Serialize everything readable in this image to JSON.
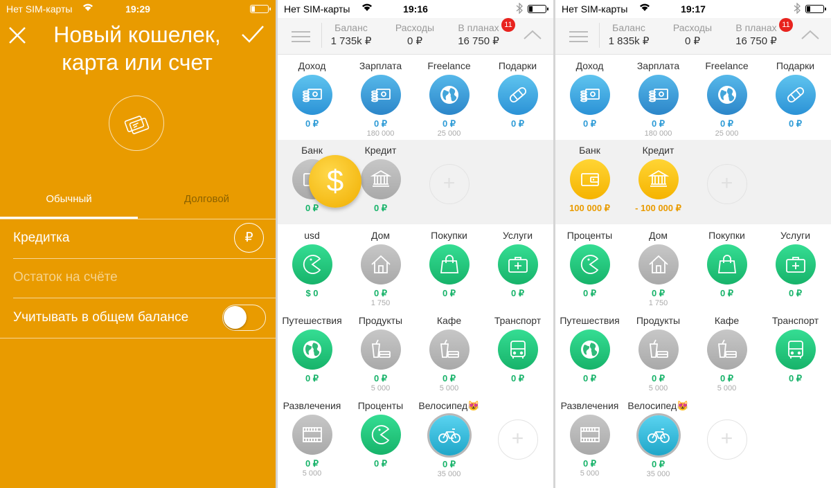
{
  "screen1": {
    "status": {
      "carrier": "Нет SIM-карты",
      "time": "19:29"
    },
    "title": "Новый кошелек, карта или счет",
    "tabs": [
      "Обычный",
      "Долговой"
    ],
    "name_value": "Кредитка",
    "currency_symbol": "₽",
    "balance_placeholder": "Остаток на счёте",
    "include_label": "Учитывать в общем балансе",
    "include_toggle": false
  },
  "screen2": {
    "status": {
      "carrier": "Нет SIM-карты",
      "time": "19:16"
    },
    "header": {
      "balance_label": "Баланс",
      "balance_value": "1 735k ₽",
      "expenses_label": "Расходы",
      "expenses_value": "0 ₽",
      "planned_label": "В планах",
      "planned_value": "16 750 ₽",
      "badge": "11"
    },
    "income": [
      {
        "name": "Доход",
        "value": "0 ₽",
        "sub": "",
        "icon": "cash-register-icon",
        "color": "blue"
      },
      {
        "name": "Зарплата",
        "value": "0 ₽",
        "sub": "180 000",
        "icon": "cash-register-icon",
        "color": "blue2"
      },
      {
        "name": "Freelance",
        "value": "0 ₽",
        "sub": "25 000",
        "icon": "globe-icon",
        "color": "blue2"
      },
      {
        "name": "Подарки",
        "value": "0 ₽",
        "sub": "",
        "icon": "bandage-icon",
        "color": "blue"
      }
    ],
    "accounts": [
      {
        "name": "Банк",
        "value": "0 ₽",
        "sub": "",
        "icon": "wallet-icon",
        "color": "grey"
      },
      {
        "name": "Кредит",
        "value": "0 ₽",
        "sub": "",
        "icon": "bank-icon",
        "color": "grey"
      }
    ],
    "drag_symbol": "$",
    "expenses": [
      {
        "name": "usd",
        "value": "$ 0",
        "sub": "",
        "icon": "pacman-icon",
        "color": "green"
      },
      {
        "name": "Дом",
        "value": "0 ₽",
        "sub": "1 750",
        "icon": "house-icon",
        "color": "grey"
      },
      {
        "name": "Покупки",
        "value": "0 ₽",
        "sub": "",
        "icon": "shopping-bag-icon",
        "color": "green"
      },
      {
        "name": "Услуги",
        "value": "0 ₽",
        "sub": "",
        "icon": "first-aid-icon",
        "color": "green"
      },
      {
        "name": "Путешествия",
        "value": "0 ₽",
        "sub": "",
        "icon": "globe-icon",
        "color": "green"
      },
      {
        "name": "Продукты",
        "value": "0 ₽",
        "sub": "5 000",
        "icon": "groceries-icon",
        "color": "grey"
      },
      {
        "name": "Кафе",
        "value": "0 ₽",
        "sub": "5 000",
        "icon": "groceries-icon",
        "color": "grey"
      },
      {
        "name": "Транспорт",
        "value": "0 ₽",
        "sub": "",
        "icon": "bus-icon",
        "color": "green"
      },
      {
        "name": "Развлечения",
        "value": "0 ₽",
        "sub": "5 000",
        "icon": "film-icon",
        "color": "grey"
      },
      {
        "name": "Проценты",
        "value": "0 ₽",
        "sub": "",
        "icon": "pacman-icon",
        "color": "green"
      },
      {
        "name": "Велосипед😻",
        "value": "0 ₽",
        "sub": "35 000",
        "icon": "bicycle-icon",
        "color": "teal"
      }
    ]
  },
  "screen3": {
    "status": {
      "carrier": "Нет SIM-карты",
      "time": "19:17"
    },
    "header": {
      "balance_label": "Баланс",
      "balance_value": "1 835k ₽",
      "expenses_label": "Расходы",
      "expenses_value": "0 ₽",
      "planned_label": "В планах",
      "planned_value": "16 750 ₽",
      "badge": "11"
    },
    "income": [
      {
        "name": "Доход",
        "value": "0 ₽",
        "sub": "",
        "icon": "cash-register-icon",
        "color": "blue"
      },
      {
        "name": "Зарплата",
        "value": "0 ₽",
        "sub": "180 000",
        "icon": "cash-register-icon",
        "color": "blue2"
      },
      {
        "name": "Freelance",
        "value": "0 ₽",
        "sub": "25 000",
        "icon": "globe-icon",
        "color": "blue2"
      },
      {
        "name": "Подарки",
        "value": "0 ₽",
        "sub": "",
        "icon": "bandage-icon",
        "color": "blue"
      }
    ],
    "accounts": [
      {
        "name": "Банк",
        "value": "100 000 ₽",
        "sub": "",
        "icon": "wallet-icon",
        "color": "yellow"
      },
      {
        "name": "Кредит",
        "value": "- 100 000 ₽",
        "sub": "",
        "icon": "bank-icon",
        "color": "yellow"
      }
    ],
    "expenses": [
      {
        "name": "Проценты",
        "value": "0 ₽",
        "sub": "",
        "icon": "pacman-icon",
        "color": "green"
      },
      {
        "name": "Дом",
        "value": "0 ₽",
        "sub": "1 750",
        "icon": "house-icon",
        "color": "grey"
      },
      {
        "name": "Покупки",
        "value": "0 ₽",
        "sub": "",
        "icon": "shopping-bag-icon",
        "color": "green"
      },
      {
        "name": "Услуги",
        "value": "0 ₽",
        "sub": "",
        "icon": "first-aid-icon",
        "color": "green"
      },
      {
        "name": "Путешествия",
        "value": "0 ₽",
        "sub": "",
        "icon": "globe-icon",
        "color": "green"
      },
      {
        "name": "Продукты",
        "value": "0 ₽",
        "sub": "5 000",
        "icon": "groceries-icon",
        "color": "grey"
      },
      {
        "name": "Кафе",
        "value": "0 ₽",
        "sub": "5 000",
        "icon": "groceries-icon",
        "color": "grey"
      },
      {
        "name": "Транспорт",
        "value": "0 ₽",
        "sub": "",
        "icon": "bus-icon",
        "color": "green"
      },
      {
        "name": "Развлечения",
        "value": "0 ₽",
        "sub": "5 000",
        "icon": "film-icon",
        "color": "grey"
      },
      {
        "name": "Велосипед😻",
        "value": "0 ₽",
        "sub": "35 000",
        "icon": "bicycle-icon",
        "color": "teal"
      }
    ]
  }
}
